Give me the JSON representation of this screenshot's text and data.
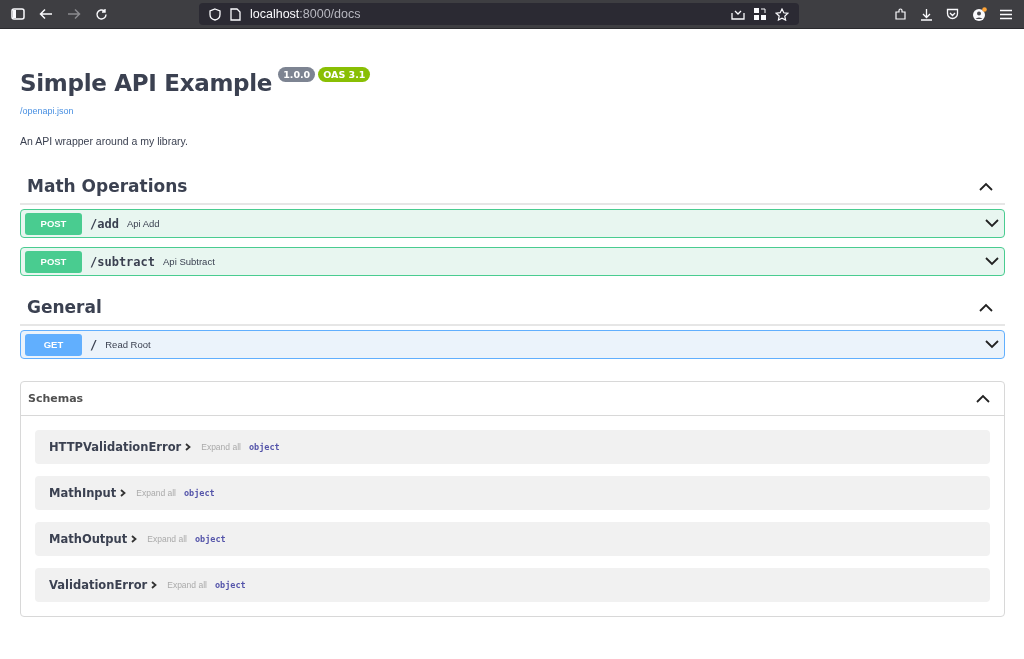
{
  "browser": {
    "url_host": "localhost",
    "url_path": ":8000/docs",
    "forward_disabled": true
  },
  "info": {
    "title": "Simple API Example",
    "version": "1.0.0",
    "oas": "OAS 3.1",
    "spec_link": "/openapi.json",
    "description": "An API wrapper around a my library."
  },
  "tags": [
    {
      "name": "Math Operations",
      "expanded": true,
      "operations": [
        {
          "method": "POST",
          "path": "/add",
          "summary": "Api Add"
        },
        {
          "method": "POST",
          "path": "/subtract",
          "summary": "Api Subtract"
        }
      ]
    },
    {
      "name": "General",
      "expanded": true,
      "operations": [
        {
          "method": "GET",
          "path": "/",
          "summary": "Read Root"
        }
      ]
    }
  ],
  "schemas": {
    "title": "Schemas",
    "expanded": true,
    "models": [
      {
        "name": "HTTPValidationError",
        "expand_label": "Expand all",
        "type": "object"
      },
      {
        "name": "MathInput",
        "expand_label": "Expand all",
        "type": "object"
      },
      {
        "name": "MathOutput",
        "expand_label": "Expand all",
        "type": "object"
      },
      {
        "name": "ValidationError",
        "expand_label": "Expand all",
        "type": "object"
      }
    ]
  }
}
